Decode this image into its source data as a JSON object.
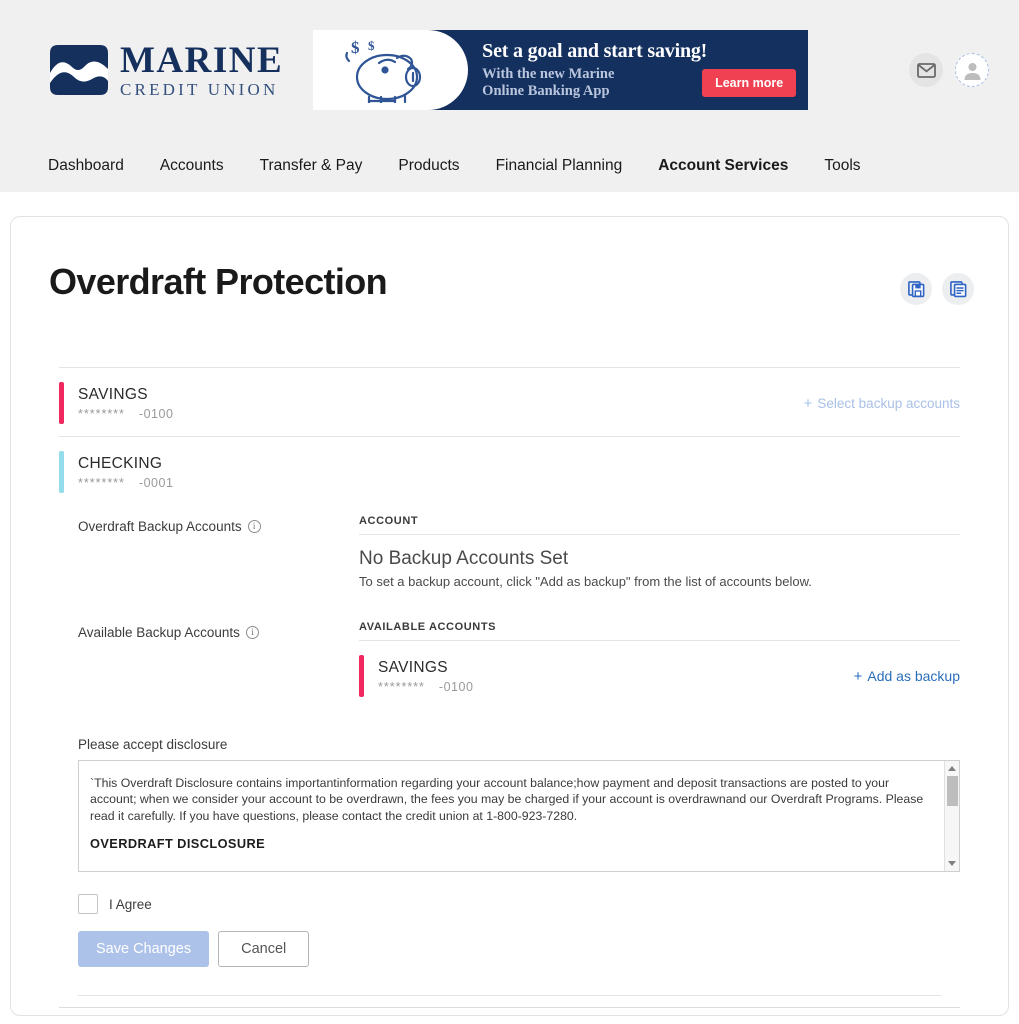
{
  "brand": {
    "name": "MARINE",
    "tagline": "CREDIT UNION",
    "logo_icon": "marine-wave-logo"
  },
  "promo_banner": {
    "headline": "Set a goal and start saving!",
    "subline_1": "With the new Marine",
    "subline_2": "Online Banking App",
    "cta_label": "Learn more",
    "art_icon": "piggy-bank-icon",
    "background_color": "#14305e",
    "cta_color": "#ef4152"
  },
  "header_icons": {
    "mail": "envelope-icon",
    "profile": "user-avatar-icon"
  },
  "nav": {
    "items": [
      {
        "label": "Dashboard",
        "active": false
      },
      {
        "label": "Accounts",
        "active": false
      },
      {
        "label": "Transfer & Pay",
        "active": false
      },
      {
        "label": "Products",
        "active": false
      },
      {
        "label": "Financial Planning",
        "active": false
      },
      {
        "label": "Account Services",
        "active": true
      },
      {
        "label": "Tools",
        "active": false
      }
    ]
  },
  "page": {
    "title": "Overdraft Protection",
    "actions": [
      {
        "icon": "save-documents-icon"
      },
      {
        "icon": "view-documents-icon"
      }
    ]
  },
  "accounts": {
    "savings": {
      "name": "SAVINGS",
      "mask": "********",
      "digits": "-0100",
      "bar_color": "#f0285f",
      "link_label": "Select backup accounts",
      "link_enabled": false
    },
    "checking": {
      "name": "CHECKING",
      "mask": "********",
      "digits": "-0001",
      "bar_color": "#92dcec"
    }
  },
  "backup_section": {
    "label": "Overdraft Backup Accounts",
    "info_icon": "info-icon",
    "column_header": "ACCOUNT",
    "empty_title": "No Backup Accounts Set",
    "empty_subtitle": "To set a backup account, click \"Add as backup\" from the list of accounts below."
  },
  "available_section": {
    "label": "Available Backup Accounts",
    "info_icon": "info-icon",
    "column_header": "AVAILABLE ACCOUNTS",
    "account": {
      "name": "SAVINGS",
      "mask": "********",
      "digits": "-0100",
      "bar_color": "#f0285f"
    },
    "add_link_label": "Add as backup"
  },
  "disclosure": {
    "label": "Please accept disclosure",
    "body": "`This Overdraft Disclosure contains importantinformation regarding your account balance;how payment and deposit transactions are posted to your account; when we consider your account to be overdrawn, the fees you may be charged if your account is overdrawnand our Overdraft Programs. Please read it carefully. If you have questions, please contact the credit union at 1-800-923-7280.",
    "heading": "OVERDRAFT DISCLOSURE",
    "scrollbar": "vertical-scrollbar"
  },
  "form_controls": {
    "agree_label": "I Agree",
    "agree_checked": false,
    "save_label": "Save Changes",
    "save_enabled": false,
    "cancel_label": "Cancel"
  }
}
